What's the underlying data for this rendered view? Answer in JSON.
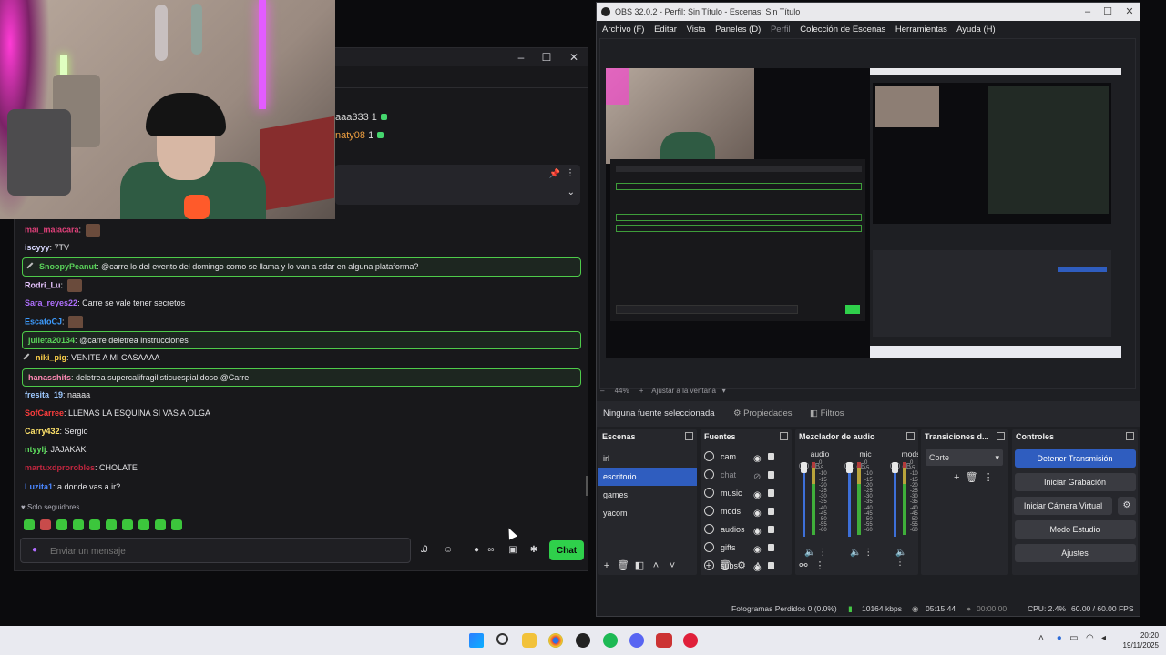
{
  "chat": {
    "top_viewers": [
      {
        "name": "aaa333",
        "count": "1"
      },
      {
        "name": "naty08",
        "count": "1"
      }
    ],
    "messages": [
      {
        "user": "mai_malacara",
        "color": "#e0407a",
        "text": "",
        "emote": true,
        "highlight": false
      },
      {
        "user": "iscyyy",
        "color": "#d8d8ff",
        "text": "7TV",
        "highlight": false
      },
      {
        "user": "SnoopyPeanut",
        "color": "#5ad35a",
        "text": "@carre lo del evento del domingo como se llama y lo van a sdar en alguna plataforma?",
        "highlight": true,
        "sword": true
      },
      {
        "user": "Rodri_Lu",
        "color": "#e7c5ff",
        "text": "",
        "emote": true,
        "highlight": false
      },
      {
        "user": "Sara_reyes22",
        "color": "#b070ff",
        "text": "Carre se vale tener secretos",
        "highlight": false
      },
      {
        "user": "EscatoCJ",
        "color": "#3d9cff",
        "text": "",
        "emote": true,
        "highlight": false
      },
      {
        "user": "julieta20134",
        "color": "#5ad35a",
        "text": "@carre deletrea instrucciones",
        "highlight": true
      },
      {
        "user": "niki_pig",
        "color": "#ffd24a",
        "text": "VENITE A MI CASAAAA",
        "highlight": false,
        "sword": true
      },
      {
        "user": "hanasshits",
        "color": "#ff8ab5",
        "text": "deletrea supercalifragilisticuespialidoso @Carre",
        "highlight": true
      },
      {
        "user": "fresita_19",
        "color": "#9ec9ff",
        "text": "naaaa",
        "highlight": false
      },
      {
        "user": "SofCarree",
        "color": "#ff3d3d",
        "text": "LLENAS LA ESQUINA SI VAS A OLGA",
        "highlight": false
      },
      {
        "user": "Carry432",
        "color": "#ffe36b",
        "text": "Sergio",
        "highlight": false
      },
      {
        "user": "ntyylj",
        "color": "#5fe05f",
        "text": "JAJAKAK",
        "highlight": false
      },
      {
        "user": "martuxdprorobles",
        "color": "#c0263f",
        "text": "CHOLATE",
        "highlight": false
      },
      {
        "user": "Luzita1",
        "color": "#4a86ff",
        "text": "a donde vas a ir?",
        "highlight": false
      }
    ],
    "followers_only": "Solo seguidores",
    "input_placeholder": "Enviar un mensaje",
    "send_label": "Chat"
  },
  "obs": {
    "title": "OBS 32.0.2 - Perfil: Sin Título - Escenas: Sin Título",
    "menu": [
      "Archivo (F)",
      "Editar",
      "Vista",
      "Paneles (D)",
      "Perfil",
      "Colección de Escenas",
      "Herramientas",
      "Ayuda (H)"
    ],
    "zoom": "44%",
    "zoom_fit": "Ajustar a la ventana",
    "no_source": "Ninguna fuente seleccionada",
    "properties": "Propiedades",
    "filters": "Filtros",
    "scenes_title": "Escenas",
    "scenes": [
      "irl",
      "escritorio",
      "games",
      "yacom"
    ],
    "selected_scene": "escritorio",
    "sources_title": "Fuentes",
    "sources": [
      {
        "name": "cam",
        "visible": true
      },
      {
        "name": "chat",
        "visible": false
      },
      {
        "name": "music",
        "visible": true
      },
      {
        "name": "mods",
        "visible": true
      },
      {
        "name": "audios",
        "visible": true
      },
      {
        "name": "gifts",
        "visible": true
      },
      {
        "name": "subs",
        "visible": true
      }
    ],
    "mixer_title": "Mezclador de audio",
    "mixer": [
      {
        "name": "audio",
        "db": "0.0 dB"
      },
      {
        "name": "mic",
        "db": "0.0 dB"
      },
      {
        "name": "mods",
        "db": "0.0 dB"
      }
    ],
    "meter_ticks": [
      "0",
      "-5",
      "-10",
      "-15",
      "-20",
      "-25",
      "-30",
      "-35",
      "-40",
      "-45",
      "-50",
      "-55",
      "-60"
    ],
    "transitions_title": "Transiciones d...",
    "transition": "Corte",
    "controls_title": "Controles",
    "controls": {
      "stop_stream": "Detener Transmisión",
      "start_record": "Iniciar Grabación",
      "start_vcam": "Iniciar Cámara Virtual",
      "studio": "Modo Estudio",
      "settings": "Ajustes"
    },
    "status": {
      "dropped": "Fotogramas Perdidos 0 (0.0%)",
      "bitrate": "10164 kbps",
      "stream_time": "05:15:44",
      "rec_time": "00:00:00",
      "cpu": "CPU: 2.4%",
      "fps": "60.00 / 60.00 FPS"
    }
  },
  "taskbar": {
    "time": "20:20",
    "date": "19/11/2025"
  }
}
